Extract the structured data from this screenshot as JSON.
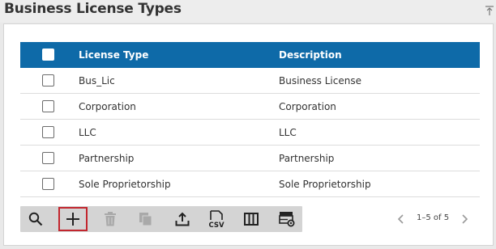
{
  "panel": {
    "title": "Business License Types"
  },
  "grid": {
    "columns": {
      "license_type": "License Type",
      "description": "Description"
    },
    "rows": [
      {
        "license_type": "Bus_Lic",
        "description": "Business License"
      },
      {
        "license_type": "Corporation",
        "description": "Corporation"
      },
      {
        "license_type": "LLC",
        "description": "LLC"
      },
      {
        "license_type": "Partnership",
        "description": "Partnership"
      },
      {
        "license_type": "Sole Proprietorship",
        "description": "Sole Proprietorship"
      }
    ]
  },
  "toolbar": {
    "buttons": [
      {
        "icon": "search-icon",
        "enabled": true
      },
      {
        "icon": "add-icon",
        "enabled": true,
        "selected": true
      },
      {
        "icon": "trash-icon",
        "enabled": false
      },
      {
        "icon": "copy-icon",
        "enabled": false
      },
      {
        "icon": "upload-icon",
        "enabled": true
      },
      {
        "icon": "csv-export-icon",
        "enabled": true
      },
      {
        "icon": "columns-icon",
        "enabled": true
      },
      {
        "icon": "grid-settings-icon",
        "enabled": true
      }
    ]
  },
  "pager": {
    "range": "1–5 of 5"
  },
  "colors": {
    "header_bg": "#0e6aa8",
    "toolbar_bg": "#d4d4d4",
    "selected_outline": "#c2262e"
  }
}
